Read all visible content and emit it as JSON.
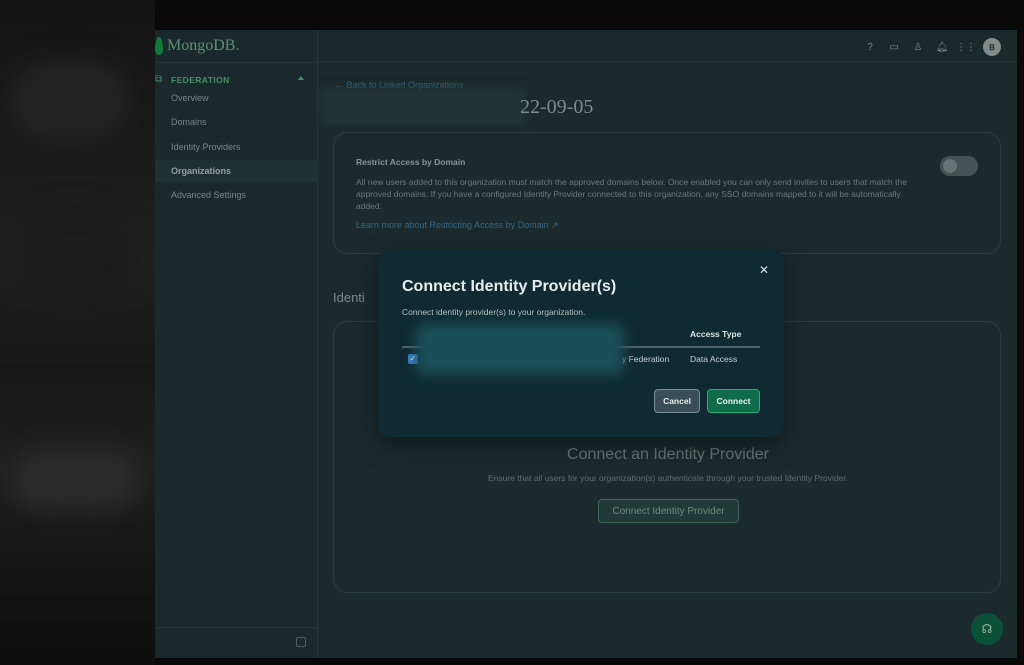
{
  "app": {
    "logo_text": "MongoDB.",
    "avatar_initial": "B"
  },
  "sidebar": {
    "section_label": "FEDERATION",
    "items": [
      {
        "label": "Overview"
      },
      {
        "label": "Domains"
      },
      {
        "label": "Identity Providers"
      },
      {
        "label": "Organizations",
        "active": true
      },
      {
        "label": "Advanced Settings"
      }
    ]
  },
  "topbar": {
    "icons": [
      "help-icon",
      "billing-icon",
      "user-access-icon",
      "bell-icon",
      "apps-grid-icon"
    ]
  },
  "page": {
    "back_link": "← Back to Linked Organizations",
    "title_suffix": "22-09-05"
  },
  "restrict_card": {
    "title": "Restrict Access by Domain",
    "text": "All new users added to this organization must match the approved domains below. Once enabled you can only send invites to users that match the approved domains. If you have a configured Identity Provider connected to this organization, any SSO domains mapped to it will be automatically added.",
    "link": "Learn more about Restricting Access by Domain",
    "toggle_on": false
  },
  "idp_section": {
    "heading": "Identi",
    "title": "Connect an Identity Provider",
    "subtitle": "Ensure that all users for your organization(s) authenticate through your trusted Identity Provider.",
    "button": "Connect Identity Provider"
  },
  "modal": {
    "title": "Connect Identity Provider(s)",
    "subtitle": "Connect identity provider(s) to your organization.",
    "column_access": "Access Type",
    "row": {
      "name_suffix": "y Federation",
      "access": "Data Access",
      "checked": true
    },
    "cancel": "Cancel",
    "connect": "Connect"
  },
  "colors": {
    "accent": "#0e6b4b",
    "link": "#3f8ab8",
    "checkbox": "#3b82c8"
  }
}
